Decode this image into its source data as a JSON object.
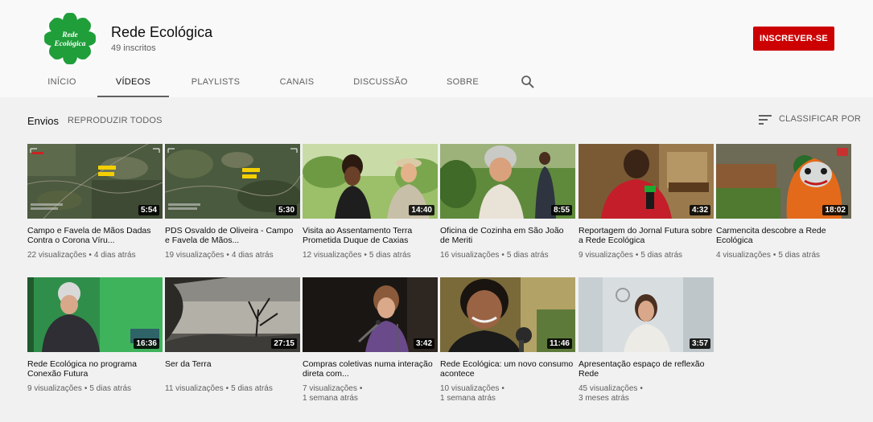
{
  "channel": {
    "name": "Rede Ecológica",
    "subscribers": "49 inscritos",
    "logo_text": [
      "Rede",
      "Ecológica"
    ],
    "subscribe_label": "INSCREVER-SE"
  },
  "tabs": [
    {
      "label": "INÍCIO"
    },
    {
      "label": "VÍDEOS"
    },
    {
      "label": "PLAYLISTS"
    },
    {
      "label": "CANAIS"
    },
    {
      "label": "DISCUSSÃO"
    },
    {
      "label": "SOBRE"
    }
  ],
  "active_tab": "VÍDEOS",
  "section": {
    "title": "Envios",
    "play_all": "REPRODUZIR TODOS",
    "sort_label": "CLASSIFICAR POR"
  },
  "videos": [
    {
      "title": "Campo e Favela de Mãos Dadas Contra o Corona Víru...",
      "duration": "5:54",
      "views": "22 visualizações",
      "age": "4 dias atrás",
      "thumb": "map"
    },
    {
      "title": "PDS Osvaldo de Oliveira - Campo e Favela de Mãos...",
      "duration": "5:30",
      "views": "19 visualizações",
      "age": "4 dias atrás",
      "thumb": "map"
    },
    {
      "title": "Visita ao Assentamento Terra Prometida Duque de Caxias",
      "duration": "14:40",
      "views": "12 visualizações",
      "age": "5 dias atrás",
      "thumb": "people-green"
    },
    {
      "title": "Oficina de Cozinha em São João de Meriti",
      "duration": "8:55",
      "views": "16 visualizações",
      "age": "5 dias atrás",
      "thumb": "people-garden"
    },
    {
      "title": "Reportagem do Jornal Futura sobre a Rede Ecológica",
      "duration": "4:32",
      "views": "9 visualizações",
      "age": "5 dias atrás",
      "thumb": "interview-red"
    },
    {
      "title": "Carmencita descobre a Rede Ecológica",
      "duration": "18:02",
      "views": "4 visualizações",
      "age": "5 dias atrás",
      "thumb": "puppet"
    },
    {
      "title": "Rede Ecológica no programa Conexão Futura",
      "duration": "16:36",
      "views": "9 visualizações",
      "age": "5 dias atrás",
      "thumb": "tv-show"
    },
    {
      "title": "Ser da Terra",
      "duration": "27:15",
      "views": "11 visualizações",
      "age": "5 dias atrás",
      "thumb": "sky"
    },
    {
      "title": "Compras coletivas numa interação direta com...",
      "duration": "3:42",
      "views": "7 visualizações",
      "age": "1 semana atrás",
      "thumb": "speaker-dark"
    },
    {
      "title": "Rede Ecológica: um novo consumo acontece",
      "duration": "11:46",
      "views": "10 visualizações",
      "age": "1 semana atrás",
      "thumb": "woman-smile"
    },
    {
      "title": "Apresentação espaço de reflexão Rede",
      "duration": "3:57",
      "views": "45 visualizações",
      "age": "3 meses atrás",
      "thumb": "woman-room"
    }
  ],
  "colors": {
    "subscribe": "#cc0000",
    "logo_green": "#1f9e3a"
  }
}
